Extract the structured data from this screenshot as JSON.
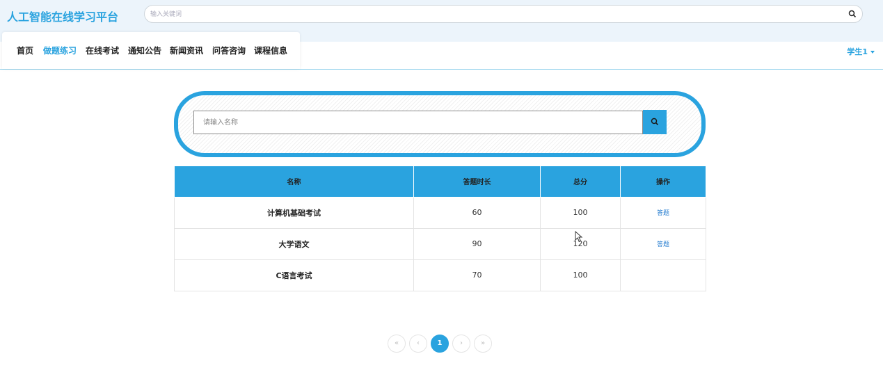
{
  "header": {
    "logo": "人工智能在线学习平台",
    "search_placeholder": "输入关键词"
  },
  "nav": {
    "items": [
      {
        "label": "首页",
        "active": false
      },
      {
        "label": "做题练习",
        "active": true
      },
      {
        "label": "在线考试",
        "active": false
      },
      {
        "label": "通知公告",
        "active": false
      },
      {
        "label": "新闻资讯",
        "active": false
      },
      {
        "label": "问答咨询",
        "active": false
      },
      {
        "label": "课程信息",
        "active": false
      }
    ],
    "user": "学生1"
  },
  "search": {
    "placeholder": "请输入名称"
  },
  "table": {
    "headers": [
      "名称",
      "答题时长",
      "总分",
      "操作"
    ],
    "rows": [
      {
        "name": "计算机基础考试",
        "duration": "60",
        "score": "100",
        "action": "答题"
      },
      {
        "name": "大学语文",
        "duration": "90",
        "score": "120",
        "action": "答题"
      },
      {
        "name": "C语言考试",
        "duration": "70",
        "score": "100",
        "action": ""
      }
    ]
  },
  "pagination": {
    "first": "«",
    "prev": "‹",
    "current": "1",
    "next": "›",
    "last": "»"
  },
  "colors": {
    "accent": "#2aa3df",
    "header_bg": "#ecf4fb"
  }
}
